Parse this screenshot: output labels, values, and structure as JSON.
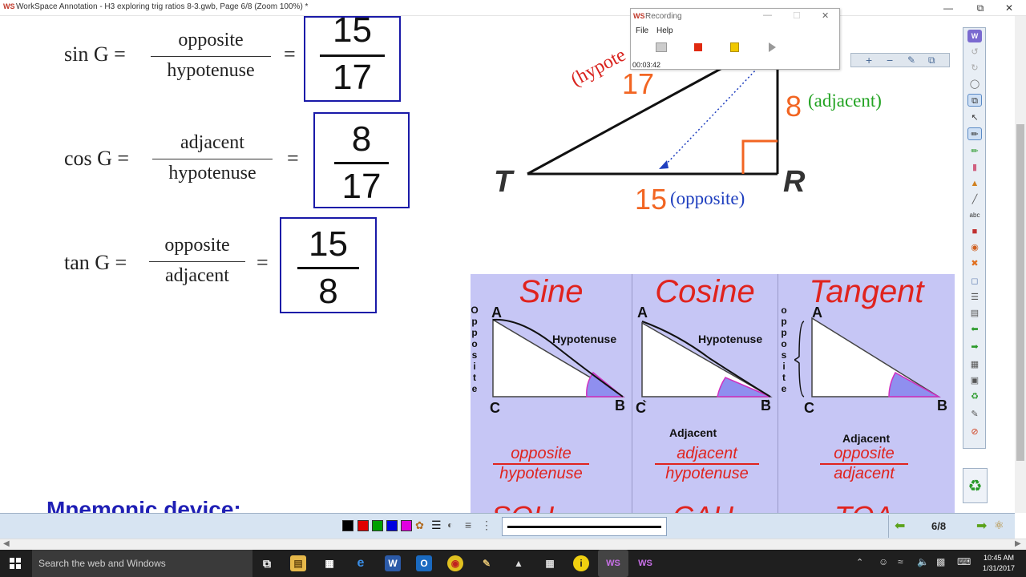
{
  "window": {
    "title": "WorkSpace Annotation - H3 exploring trig ratios 8-3.gwb, Page 6/8  (Zoom 100%) *",
    "app_logo": "WS",
    "controls": [
      "minimize-icon",
      "restore-icon",
      "close-icon"
    ]
  },
  "formulas": [
    {
      "label": "sin G =",
      "num": "opposite",
      "den": "hypotenuse",
      "eq": "=",
      "ans_num": "15",
      "ans_den": "17"
    },
    {
      "label": "cos G =",
      "num": "adjacent",
      "den": "hypotenuse",
      "eq": "=",
      "ans_num": "8",
      "ans_den": "17"
    },
    {
      "label": "tan G =",
      "num": "opposite",
      "den": "adjacent",
      "eq": "=",
      "ans_num": "15",
      "ans_den": "8"
    }
  ],
  "triangle": {
    "vertex_t": "T",
    "vertex_r": "R",
    "side_17": "17",
    "side_8": "8",
    "side_15": "15",
    "hyp_label": "(hypote",
    "adj_label": "(adjacent)",
    "opp_label": "(opposite)"
  },
  "mnemonic": {
    "label": "Mnemonic device:",
    "cut_off": [
      "SOH",
      "CAH",
      "TOA"
    ]
  },
  "trig_table": [
    {
      "title": "Sine",
      "num": "opposite",
      "den": "hypotenuse",
      "a": "A",
      "b": "B",
      "c": "C",
      "hyp": "Hypotenuse",
      "adj": "",
      "vert": [
        "O",
        "p",
        "p",
        "o",
        "s",
        "i",
        "t",
        "e"
      ]
    },
    {
      "title": "Cosine",
      "num": "adjacent",
      "den": "hypotenuse",
      "a": "A",
      "b": "B",
      "c": "C",
      "hyp": "Hypotenuse",
      "adj": "Adjacent",
      "vert": []
    },
    {
      "title": "Tangent",
      "num": "opposite",
      "den": "adjacent",
      "a": "A",
      "b": "B",
      "c": "C",
      "hyp": "",
      "adj": "Adjacent",
      "vert": [
        "o",
        "p",
        "p",
        "o",
        "s",
        "i",
        "t",
        "e"
      ]
    }
  ],
  "recording": {
    "logo": "WS",
    "title": "Recording",
    "menu": [
      "File",
      "Help"
    ],
    "time": "00:03:42"
  },
  "pager": {
    "page": "6/8"
  },
  "taskbar": {
    "search_placeholder": "Search the web and Windows",
    "time": "10:45 AM",
    "date": "1/31/2017",
    "apps": [
      "WS",
      "WS"
    ]
  },
  "colors": {
    "answer_box": "#1a1aa8",
    "triangle_orange": "#f26522",
    "hyp_red": "#d9231e",
    "adj_green": "#22a322",
    "opp_blue": "#1f3fbf",
    "table_bg": "#c6c6f5",
    "table_red": "#e0231e",
    "pen_colors": [
      "#000000",
      "#e00000",
      "#00a000",
      "#0000e0",
      "#e000e0"
    ]
  }
}
